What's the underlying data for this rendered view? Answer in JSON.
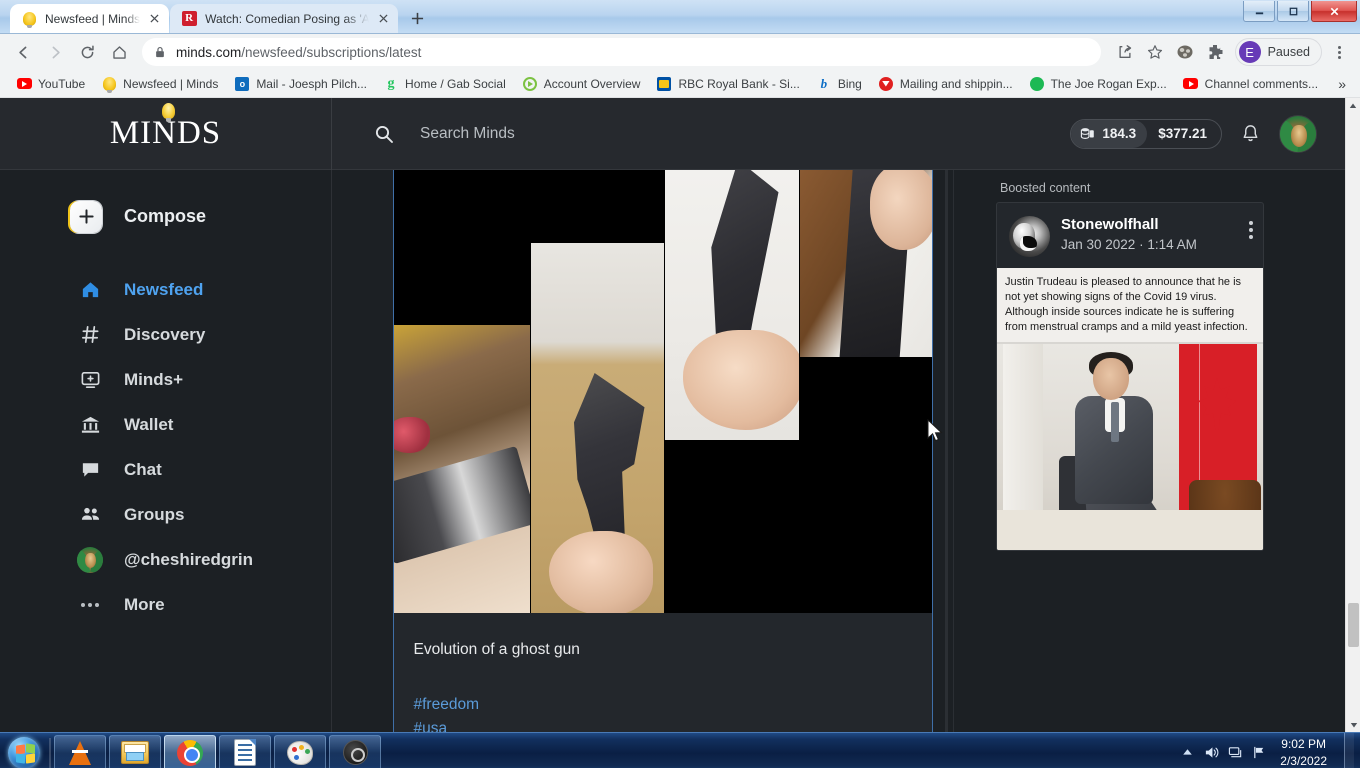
{
  "browser": {
    "tabs": [
      {
        "title": "Newsfeed | Minds",
        "favicon": "minds-bulb-icon",
        "active": true
      },
      {
        "title": "Watch: Comedian Posing as 'Ant",
        "favicon": "rumble-icon",
        "active": false
      }
    ],
    "new_tab_tooltip": "New tab",
    "nav": {
      "back": "Back",
      "forward": "Forward",
      "reload": "Reload",
      "home": "Home"
    },
    "address": {
      "host": "minds.com",
      "path": "/newsfeed/subscriptions/latest",
      "lock": "secure-lock-icon"
    },
    "omni_actions": [
      "share-icon",
      "bookmark-star-icon"
    ],
    "extensions": [
      "film-extension-icon",
      "puzzle-extension-icon"
    ],
    "profile": {
      "initial": "E",
      "label": "Paused"
    },
    "menu": "chrome-menu-icon",
    "bookmarks": [
      {
        "label": "YouTube",
        "icon": "youtube-icon"
      },
      {
        "label": "Newsfeed | Minds",
        "icon": "minds-bulb-icon"
      },
      {
        "label": "Mail - Joesph Pilch...",
        "icon": "outlook-icon"
      },
      {
        "label": "Home / Gab Social",
        "icon": "gab-icon"
      },
      {
        "label": "Account Overview",
        "icon": "account-icon"
      },
      {
        "label": "RBC Royal Bank - Si...",
        "icon": "rbc-icon"
      },
      {
        "label": "Bing",
        "icon": "bing-icon"
      },
      {
        "label": "Mailing and shippin...",
        "icon": "mail-icon"
      },
      {
        "label": "The Joe Rogan Exp...",
        "icon": "spotify-icon"
      },
      {
        "label": "Channel comments...",
        "icon": "youtube-icon"
      }
    ],
    "bookmarks_overflow": "»",
    "window_controls": {
      "minimize": "minimize-icon",
      "maximize": "maximize-icon",
      "close": "close-icon"
    }
  },
  "minds": {
    "logo": "MINDS",
    "search": {
      "placeholder": "Search Minds",
      "value": "",
      "icon": "search-icon"
    },
    "wallet": {
      "tokens": "184.3",
      "usd": "$377.21",
      "token_icon": "tokens-icon"
    },
    "notifications_icon": "bell-icon",
    "avatar": "user-avatar",
    "sidebar": [
      {
        "label": "Compose",
        "icon": "compose-plus-icon",
        "active": false
      },
      {
        "label": "Newsfeed",
        "icon": "home-icon",
        "active": true
      },
      {
        "label": "Discovery",
        "icon": "hashtag-icon",
        "active": false
      },
      {
        "label": "Minds+",
        "icon": "plus-screen-icon",
        "active": false
      },
      {
        "label": "Wallet",
        "icon": "bank-icon",
        "active": false
      },
      {
        "label": "Chat",
        "icon": "chat-bubble-icon",
        "active": false
      },
      {
        "label": "Groups",
        "icon": "groups-icon",
        "active": false
      },
      {
        "label": "@cheshiredgrin",
        "icon": "user-avatar-icon",
        "active": false
      },
      {
        "label": "More",
        "icon": "ellipsis-icon",
        "active": false
      }
    ],
    "post": {
      "text": "Evolution of a ghost gun",
      "hashtags": [
        "#freedom",
        "#usa"
      ],
      "media_alt": "collage of ghost gun assembly photos"
    },
    "right_rail": {
      "label": "Boosted content",
      "boost": {
        "author": "Stonewolfhall",
        "date": "Jan 30 2022 · 1:14 AM",
        "menu_icon": "kebab-menu-icon",
        "meme_text": "Justin Trudeau is pleased to announce that he is not yet showing signs of the Covid 19 virus. Although inside sources indicate he is suffering from menstrual cramps and a mild yeast infection.",
        "image_alt": "Justin Trudeau seated beside Canadian flag"
      }
    }
  },
  "taskbar": {
    "start": "windows-start-orb",
    "items": [
      {
        "name": "vlc-media-player",
        "active": false
      },
      {
        "name": "file-explorer",
        "active": false
      },
      {
        "name": "google-chrome",
        "active": true
      },
      {
        "name": "document-editor",
        "active": false
      },
      {
        "name": "paint",
        "active": false
      },
      {
        "name": "obs-studio",
        "active": false
      }
    ],
    "tray": [
      "show-hidden-icons",
      "volume-icon",
      "network-icon",
      "action-flag-icon"
    ],
    "clock": {
      "time": "9:02 PM",
      "date": "2/3/2022"
    }
  }
}
